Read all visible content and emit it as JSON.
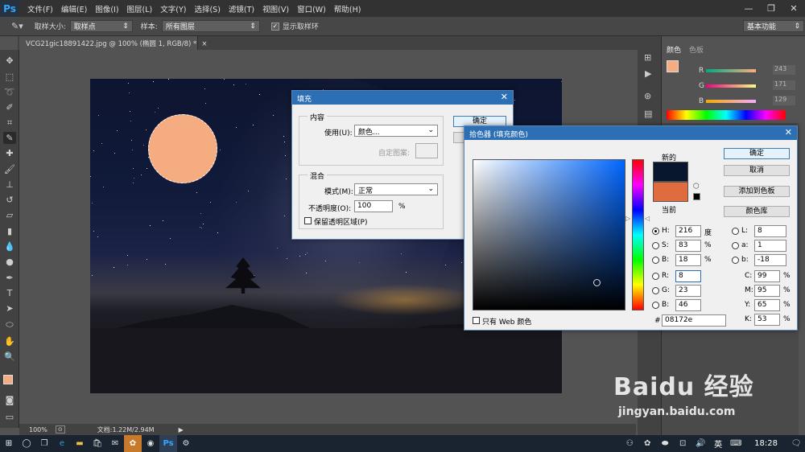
{
  "app": {
    "logo": "Ps"
  },
  "menu": [
    "文件(F)",
    "编辑(E)",
    "图像(I)",
    "图层(L)",
    "文字(Y)",
    "选择(S)",
    "滤镜(T)",
    "视图(V)",
    "窗口(W)",
    "帮助(H)"
  ],
  "options": {
    "sample_size_label": "取样大小:",
    "sample_size_value": "取样点",
    "sample_label": "样本:",
    "sample_value": "所有图层",
    "show_ring_label": "显示取样环",
    "workspace": "基本功能"
  },
  "document": {
    "tab_title": "VCG21gic18891422.jpg @ 100% (椭圆 1, RGB/8) *",
    "zoom": "100%",
    "doc_info": "文档:1.22M/2.94M"
  },
  "panel": {
    "tab_color": "颜色",
    "tab_swatches": "色板",
    "r_label": "R",
    "r_value": "243",
    "g_label": "G",
    "g_value": "171",
    "b_label": "B",
    "b_value": "129"
  },
  "fill_dialog": {
    "title": "填充",
    "content_group": "内容",
    "use_label": "使用(U):",
    "use_value": "颜色...",
    "custom_pattern_label": "自定图案:",
    "blend_group": "混合",
    "mode_label": "模式(M):",
    "mode_value": "正常",
    "opacity_label": "不透明度(O):",
    "opacity_value": "100",
    "opacity_unit": "%",
    "preserve_label": "保留透明区域(P)",
    "ok": "确定"
  },
  "picker": {
    "title": "拾色器 (填充颜色)",
    "new_label": "新的",
    "current_label": "当前",
    "ok": "确定",
    "cancel": "取消",
    "add_swatch": "添加到色板",
    "color_libraries": "颜色库",
    "web_only": "只有 Web 颜色",
    "hex_label": "#",
    "hex_value": "08172e",
    "new_color": "#08172e",
    "current_color": "#e06b3f",
    "fields": {
      "H": {
        "label": "H:",
        "value": "216",
        "unit": "度"
      },
      "S": {
        "label": "S:",
        "value": "83",
        "unit": "%"
      },
      "B": {
        "label": "B:",
        "value": "18",
        "unit": "%"
      },
      "R": {
        "label": "R:",
        "value": "8"
      },
      "G": {
        "label": "G:",
        "value": "23"
      },
      "Bb": {
        "label": "B:",
        "value": "46"
      },
      "L": {
        "label": "L:",
        "value": "8"
      },
      "a": {
        "label": "a:",
        "value": "1"
      },
      "b": {
        "label": "b:",
        "value": "-18"
      },
      "C": {
        "label": "C:",
        "value": "99",
        "unit": "%"
      },
      "M": {
        "label": "M:",
        "value": "95",
        "unit": "%"
      },
      "Y": {
        "label": "Y:",
        "value": "65",
        "unit": "%"
      },
      "K": {
        "label": "K:",
        "value": "53",
        "unit": "%"
      }
    }
  },
  "foreground_color": "#f4ac80",
  "taskbar": {
    "ime": "英",
    "time": "18:28"
  },
  "watermark": {
    "brand": "Baidu 经验",
    "url": "jingyan.baidu.com"
  }
}
